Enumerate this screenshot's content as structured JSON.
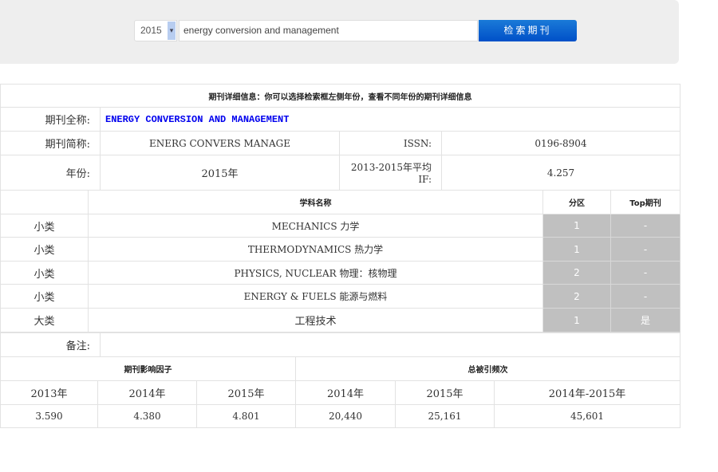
{
  "search": {
    "year": "2015",
    "query": "energy conversion and management",
    "button": "检索期刊"
  },
  "info": {
    "header": "期刊详细信息：你可以选择检索框左侧年份，查看不同年份的期刊详细信息",
    "full_name_label": "期刊全称:",
    "full_name": "ENERGY CONVERSION AND MANAGEMENT",
    "abbr_label": "期刊简称:",
    "abbr": "ENERG CONVERS MANAGE",
    "issn_label": "ISSN:",
    "issn": "0196-8904",
    "year_label": "年份:",
    "year": "2015年",
    "avg_if_label": "2013-2015年平均IF:",
    "avg_if": "4.257"
  },
  "subjects": {
    "col_name": "学科名称",
    "col_zone": "分区",
    "col_top": "Top期刊",
    "rows": [
      {
        "type": "小类",
        "name": "MECHANICS 力学",
        "zone": "1",
        "top": "-"
      },
      {
        "type": "小类",
        "name": "THERMODYNAMICS 热力学",
        "zone": "1",
        "top": "-"
      },
      {
        "type": "小类",
        "name": "PHYSICS, NUCLEAR 物理：核物理",
        "zone": "2",
        "top": "-"
      },
      {
        "type": "小类",
        "name": "ENERGY & FUELS 能源与燃料",
        "zone": "2",
        "top": "-"
      },
      {
        "type": "大类",
        "name": "工程技术",
        "zone": "1",
        "top": "是"
      }
    ],
    "remark_label": "备注:"
  },
  "metrics": {
    "if_header": "期刊影响因子",
    "cite_header": "总被引频次",
    "cols": [
      "2013年",
      "2014年",
      "2015年",
      "2014年",
      "2015年",
      "2014年-2015年"
    ],
    "vals": [
      "3.590",
      "4.380",
      "4.801",
      "20,440",
      "25,161",
      "45,601"
    ]
  }
}
